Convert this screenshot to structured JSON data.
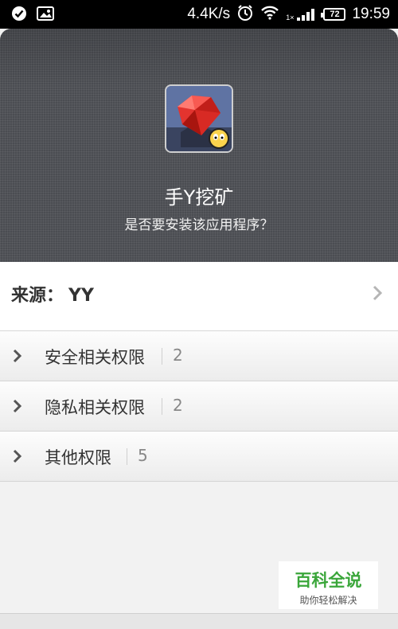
{
  "status_bar": {
    "network_speed": "4.4K/s",
    "battery_level": "72",
    "time": "19:59",
    "signal_label": "1×"
  },
  "app": {
    "name": "手Y挖矿",
    "install_question": "是否要安装该应用程序？",
    "icon": "gem-game-icon"
  },
  "source": {
    "label": "来源：",
    "value": "YY"
  },
  "permissions": [
    {
      "label": "安全相关权限",
      "count": "2"
    },
    {
      "label": "隐私相关权限",
      "count": "2"
    },
    {
      "label": "其他权限",
      "count": "5"
    }
  ],
  "watermark": {
    "title": "百科全说",
    "subtitle": "助你轻松解决"
  }
}
